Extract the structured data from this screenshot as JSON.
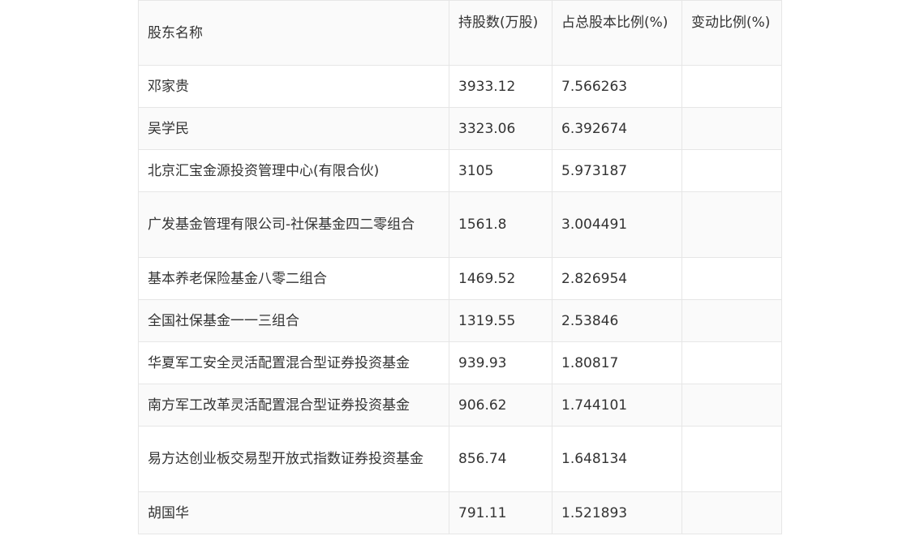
{
  "table": {
    "headers": {
      "name": "股东名称",
      "shares": "持股数(万股)",
      "ratio": "占总股本比例(%)",
      "change": "变动比例(%)"
    },
    "rows": [
      {
        "name": "邓家贵",
        "shares": "3933.12",
        "ratio": "7.566263",
        "change": ""
      },
      {
        "name": "吴学民",
        "shares": "3323.06",
        "ratio": "6.392674",
        "change": ""
      },
      {
        "name": "北京汇宝金源投资管理中心(有限合伙)",
        "shares": "3105",
        "ratio": "5.973187",
        "change": ""
      },
      {
        "name": "广发基金管理有限公司-社保基金四二零组合",
        "shares": "1561.8",
        "ratio": "3.004491",
        "change": ""
      },
      {
        "name": "基本养老保险基金八零二组合",
        "shares": "1469.52",
        "ratio": "2.826954",
        "change": ""
      },
      {
        "name": "全国社保基金一一三组合",
        "shares": "1319.55",
        "ratio": "2.53846",
        "change": ""
      },
      {
        "name": "华夏军工安全灵活配置混合型证券投资基金",
        "shares": "939.93",
        "ratio": "1.80817",
        "change": ""
      },
      {
        "name": "南方军工改革灵活配置混合型证券投资基金",
        "shares": "906.62",
        "ratio": "1.744101",
        "change": ""
      },
      {
        "name": "易方达创业板交易型开放式指数证券投资基金",
        "shares": "856.74",
        "ratio": "1.648134",
        "change": ""
      },
      {
        "name": "胡国华",
        "shares": "791.11",
        "ratio": "1.521893",
        "change": ""
      }
    ]
  }
}
